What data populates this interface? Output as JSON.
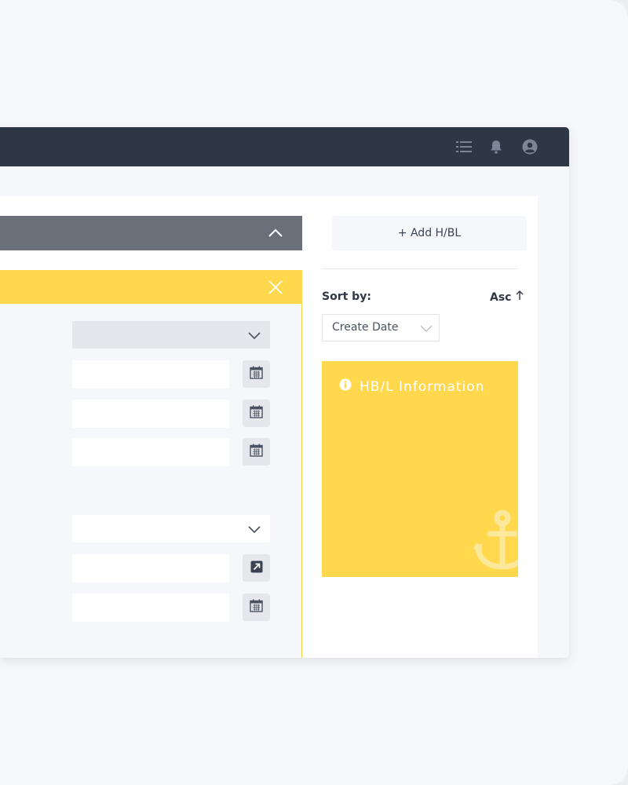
{
  "topbar": {
    "icons": [
      "list-icon",
      "bell-icon",
      "user-icon"
    ]
  },
  "form": {
    "fields": [
      {
        "type": "select",
        "value": ""
      },
      {
        "type": "date",
        "value": ""
      },
      {
        "type": "date",
        "value": ""
      },
      {
        "type": "date",
        "value": ""
      },
      {
        "type": "select",
        "value": ""
      },
      {
        "type": "link",
        "value": ""
      },
      {
        "type": "date",
        "value": ""
      }
    ]
  },
  "sidebar": {
    "add_label": "+ Add H/BL",
    "sort_label": "Sort by:",
    "sort_order": "Asc",
    "sort_value": "Create Date",
    "info_title": "HB/L Information"
  },
  "colors": {
    "topbar": "#2d3746",
    "accent_yellow": "#ffd84d",
    "section_gray": "#6a7079"
  }
}
